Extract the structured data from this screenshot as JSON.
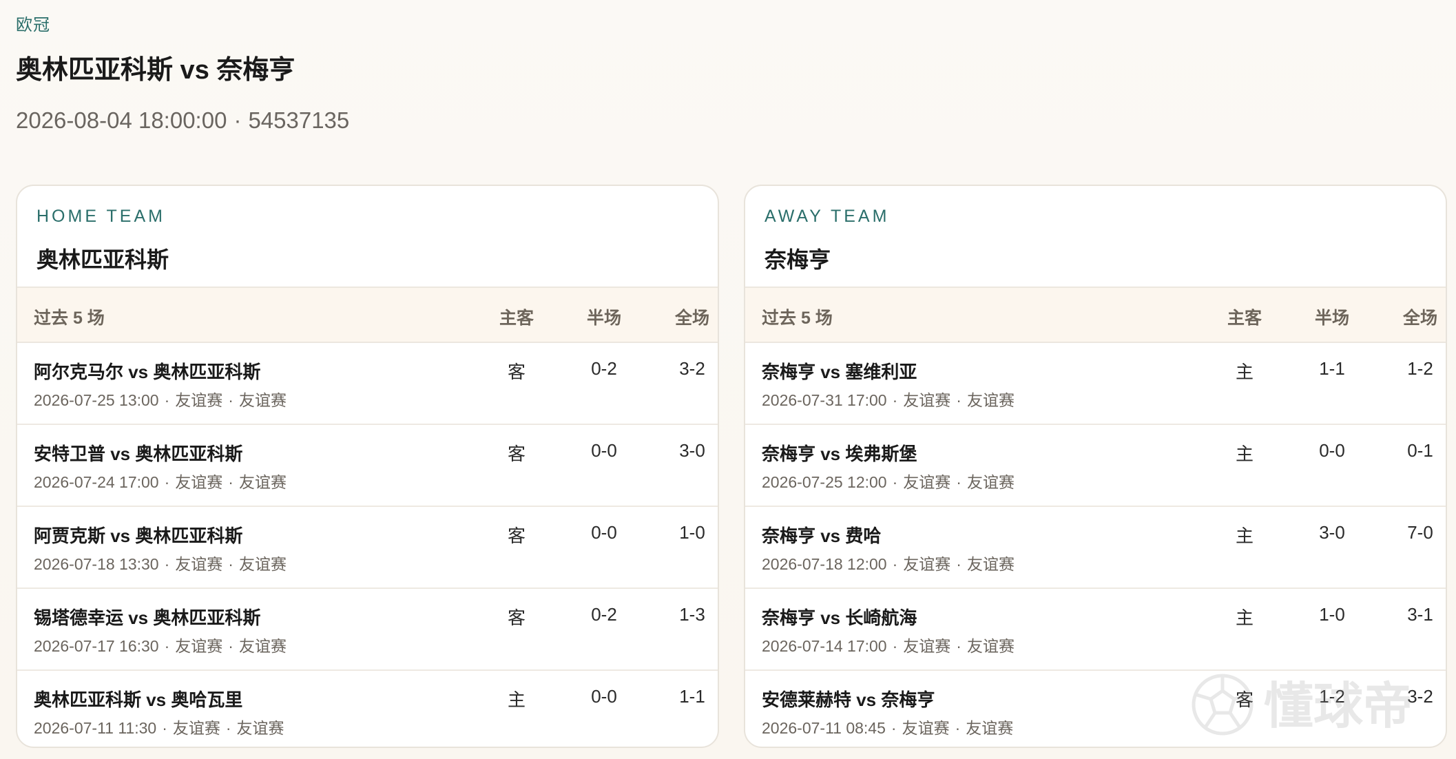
{
  "header": {
    "league": "欧冠",
    "title": "奥林匹亚科斯 vs 奈梅亨",
    "datetime": "2026-08-04 18:00:00",
    "separator": "·",
    "match_id": "54537135"
  },
  "columns": {
    "match": "过去 5 场",
    "side": "主客",
    "half": "半场",
    "full": "全场"
  },
  "home": {
    "label": "HOME TEAM",
    "name": "奥林匹亚科斯",
    "matches": [
      {
        "teams": "阿尔克马尔 vs 奥林匹亚科斯",
        "date": "2026-07-25 13:00",
        "comp1": "友谊赛",
        "comp2": "友谊赛",
        "side": "客",
        "half": "0-2",
        "full": "3-2"
      },
      {
        "teams": "安特卫普 vs 奥林匹亚科斯",
        "date": "2026-07-24 17:00",
        "comp1": "友谊赛",
        "comp2": "友谊赛",
        "side": "客",
        "half": "0-0",
        "full": "3-0"
      },
      {
        "teams": "阿贾克斯 vs 奥林匹亚科斯",
        "date": "2026-07-18 13:30",
        "comp1": "友谊赛",
        "comp2": "友谊赛",
        "side": "客",
        "half": "0-0",
        "full": "1-0"
      },
      {
        "teams": "锡塔德幸运 vs 奥林匹亚科斯",
        "date": "2026-07-17 16:30",
        "comp1": "友谊赛",
        "comp2": "友谊赛",
        "side": "客",
        "half": "0-2",
        "full": "1-3"
      },
      {
        "teams": "奥林匹亚科斯 vs 奥哈瓦里",
        "date": "2026-07-11 11:30",
        "comp1": "友谊赛",
        "comp2": "友谊赛",
        "side": "主",
        "half": "0-0",
        "full": "1-1"
      }
    ]
  },
  "away": {
    "label": "AWAY TEAM",
    "name": "奈梅亨",
    "matches": [
      {
        "teams": "奈梅亨 vs 塞维利亚",
        "date": "2026-07-31 17:00",
        "comp1": "友谊赛",
        "comp2": "友谊赛",
        "side": "主",
        "half": "1-1",
        "full": "1-2"
      },
      {
        "teams": "奈梅亨 vs 埃弗斯堡",
        "date": "2026-07-25 12:00",
        "comp1": "友谊赛",
        "comp2": "友谊赛",
        "side": "主",
        "half": "0-0",
        "full": "0-1"
      },
      {
        "teams": "奈梅亨 vs 费哈",
        "date": "2026-07-18 12:00",
        "comp1": "友谊赛",
        "comp2": "友谊赛",
        "side": "主",
        "half": "3-0",
        "full": "7-0"
      },
      {
        "teams": "奈梅亨 vs 长崎航海",
        "date": "2026-07-14 17:00",
        "comp1": "友谊赛",
        "comp2": "友谊赛",
        "side": "主",
        "half": "1-0",
        "full": "3-1"
      },
      {
        "teams": "安德莱赫特 vs 奈梅亨",
        "date": "2026-07-11 08:45",
        "comp1": "友谊赛",
        "comp2": "友谊赛",
        "side": "客",
        "half": "1-2",
        "full": "3-2"
      }
    ]
  },
  "watermark": {
    "text": "懂球帝",
    "icon": "football-logo-icon"
  },
  "colors": {
    "accent": "#2a6e6a",
    "background": "#fbf8f3",
    "table_header_bg": "#fcf6ee"
  }
}
